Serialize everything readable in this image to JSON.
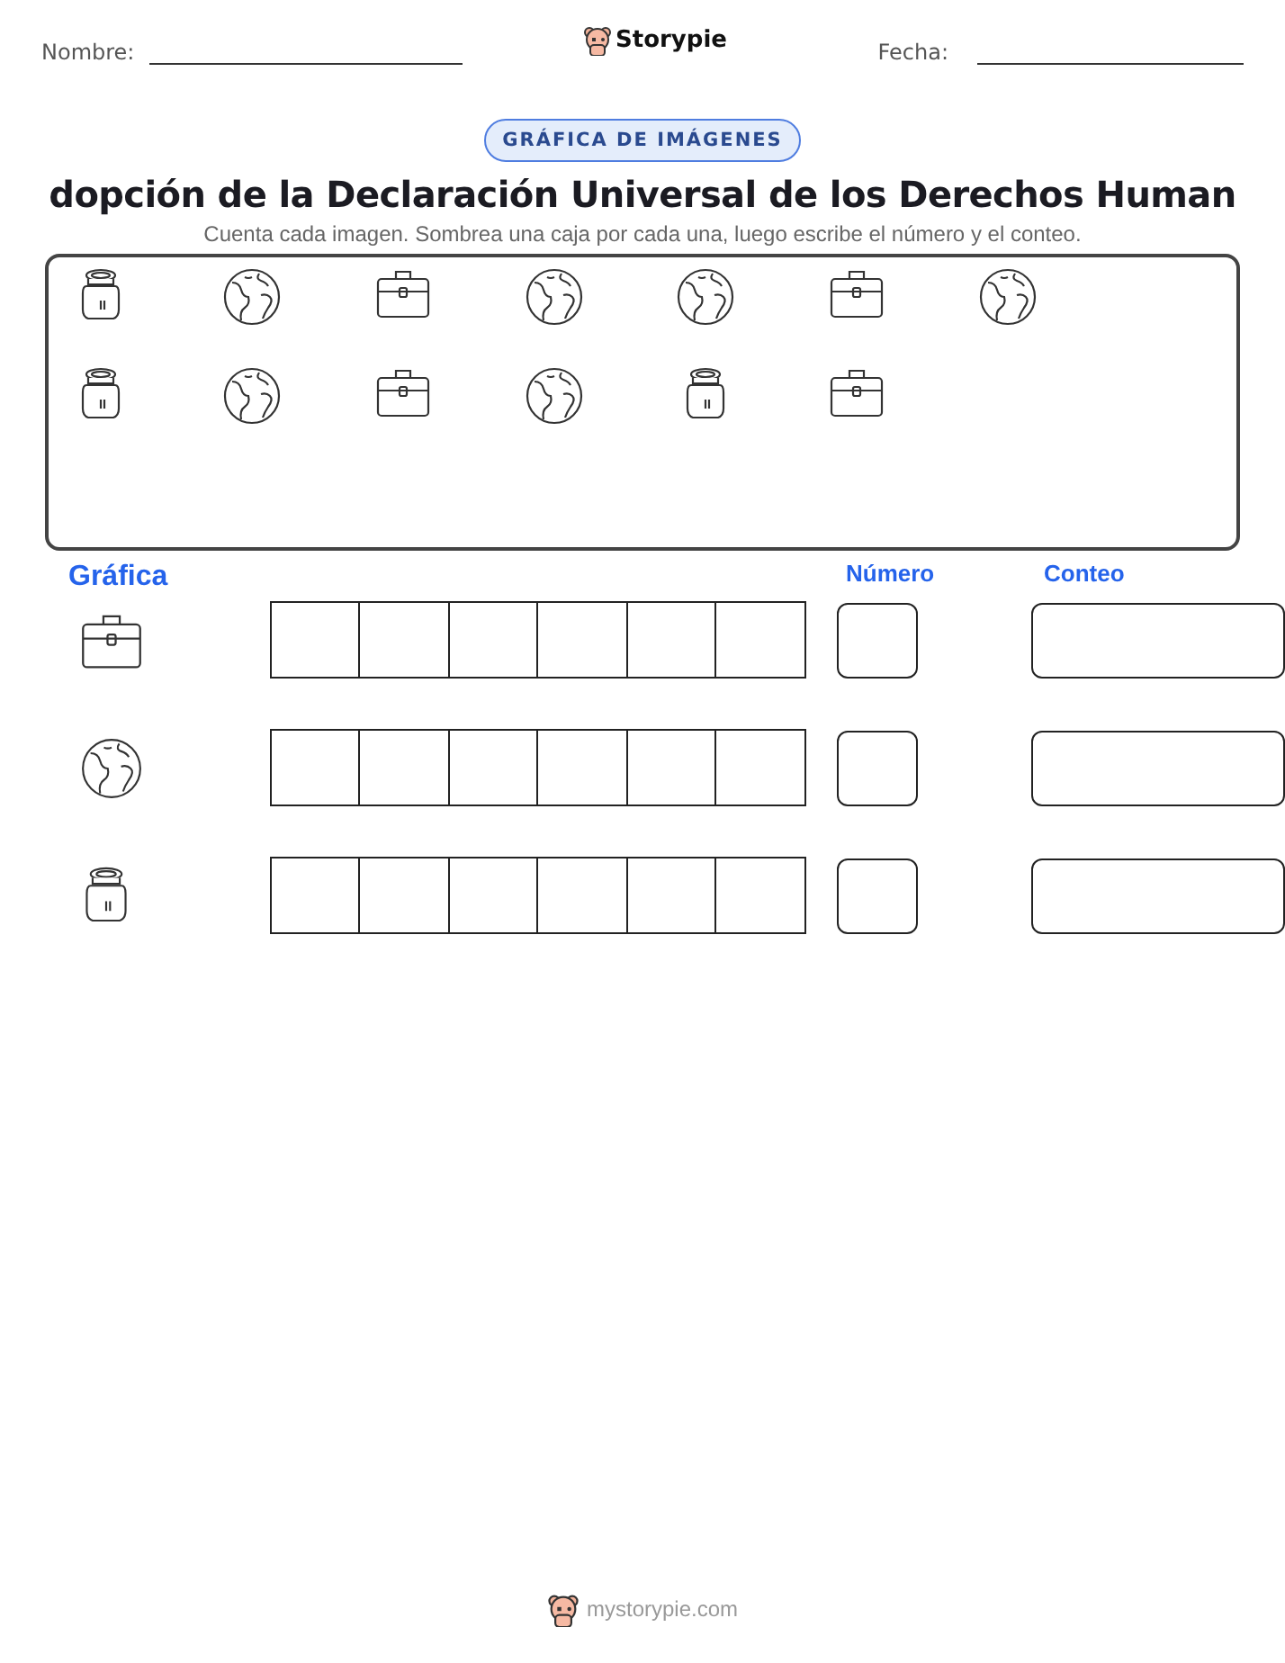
{
  "header": {
    "name_label": "Nombre:",
    "brand": "Storypie",
    "date_label": "Fecha:"
  },
  "badge": "GRÁFICA DE IMÁGENES",
  "title": "dopción de la Declaración Universal de los Derechos Human",
  "instructions": "Cuenta cada imagen. Sombrea una caja por cada una, luego escribe el número y el conteo.",
  "pictures": [
    [
      {
        "kind": "jar"
      },
      {
        "kind": "globe"
      },
      {
        "kind": "briefcase"
      },
      {
        "kind": "globe"
      },
      {
        "kind": "globe"
      },
      {
        "kind": "briefcase"
      },
      {
        "kind": "globe"
      }
    ],
    [
      {
        "kind": "jar"
      },
      {
        "kind": "globe"
      },
      {
        "kind": "briefcase"
      },
      {
        "kind": "globe"
      },
      {
        "kind": "jar"
      },
      {
        "kind": "briefcase"
      }
    ]
  ],
  "graph": {
    "heading": "Gráfica",
    "number_heading": "Número",
    "count_heading": "Conteo",
    "rows": [
      {
        "kind": "briefcase"
      },
      {
        "kind": "globe"
      },
      {
        "kind": "jar"
      }
    ]
  },
  "footer": "mystorypie.com"
}
